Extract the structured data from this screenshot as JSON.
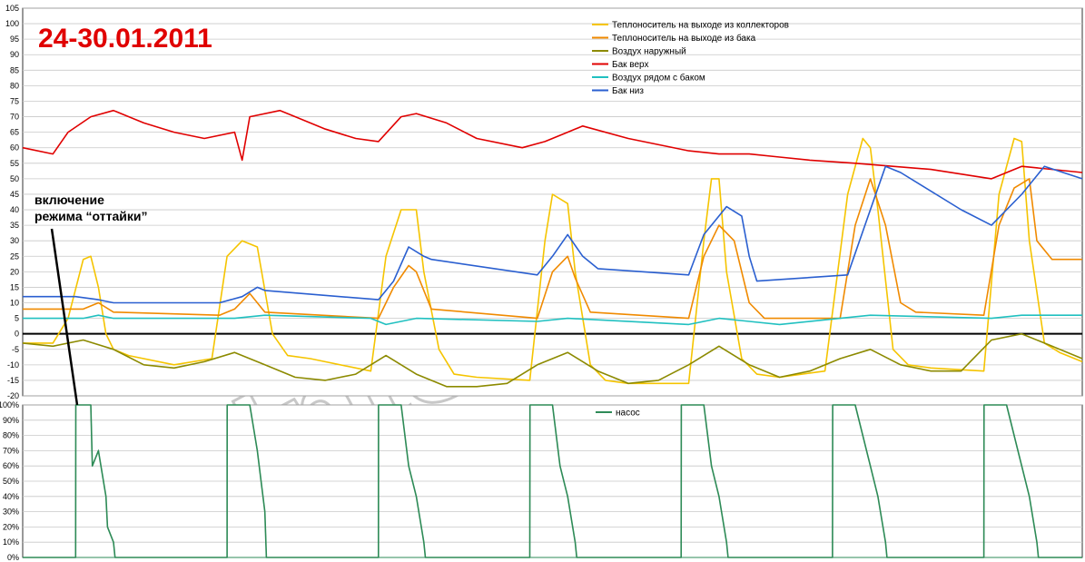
{
  "title": "24-30.01.2011",
  "annotation": "включение режима “оттайки”",
  "annotation_lines": [
    "включение",
    "режима “оттайки”"
  ],
  "watermark": "SintSolar",
  "chart_data": [
    {
      "type": "line",
      "title": "24-30.01.2011",
      "ylim": [
        -20,
        105
      ],
      "y_ticks": [
        -20,
        -15,
        -10,
        -5,
        0,
        5,
        10,
        15,
        20,
        25,
        30,
        35,
        40,
        45,
        50,
        55,
        60,
        65,
        70,
        75,
        80,
        85,
        90,
        95,
        100,
        105
      ],
      "grid": true,
      "legend_position": "top-right",
      "x_range": [
        0,
        7
      ],
      "series": [
        {
          "name": "Теплоноситель на выходе из коллекторов",
          "color": "#f5c400",
          "x": [
            0,
            0.2,
            0.3,
            0.4,
            0.45,
            0.5,
            0.55,
            0.6,
            0.7,
            1.0,
            1.25,
            1.35,
            1.45,
            1.55,
            1.65,
            1.75,
            1.9,
            2.3,
            2.4,
            2.5,
            2.6,
            2.65,
            2.75,
            2.85,
            3.0,
            3.35,
            3.45,
            3.5,
            3.6,
            3.65,
            3.75,
            3.85,
            4.0,
            4.4,
            4.5,
            4.55,
            4.6,
            4.65,
            4.75,
            4.85,
            5.0,
            5.3,
            5.45,
            5.55,
            5.6,
            5.65,
            5.75,
            5.85,
            6.0,
            6.35,
            6.45,
            6.55,
            6.6,
            6.65,
            6.75,
            6.85,
            7.0
          ],
          "values": [
            -3,
            -3,
            5,
            24,
            25,
            15,
            0,
            -5,
            -7,
            -10,
            -8,
            25,
            30,
            28,
            0,
            -7,
            -8,
            -12,
            25,
            40,
            40,
            20,
            -5,
            -13,
            -14,
            -15,
            30,
            45,
            42,
            20,
            -10,
            -15,
            -16,
            -16,
            30,
            50,
            50,
            20,
            -8,
            -13,
            -14,
            -12,
            45,
            63,
            60,
            40,
            -5,
            -10,
            -11,
            -12,
            45,
            63,
            62,
            30,
            -3,
            -6,
            -9
          ]
        },
        {
          "name": "Теплоноситель на выходе из бака",
          "color": "#f08a00",
          "x": [
            0,
            0.4,
            0.5,
            0.6,
            1.3,
            1.4,
            1.5,
            1.6,
            2.35,
            2.45,
            2.55,
            2.6,
            2.7,
            3.4,
            3.5,
            3.6,
            3.65,
            3.75,
            4.4,
            4.5,
            4.6,
            4.7,
            4.8,
            4.9,
            5.4,
            5.5,
            5.6,
            5.7,
            5.8,
            5.9,
            6.35,
            6.45,
            6.55,
            6.65,
            6.7,
            6.8,
            7.0
          ],
          "values": [
            8,
            8,
            10,
            7,
            6,
            8,
            13,
            7,
            5,
            15,
            22,
            20,
            8,
            5,
            20,
            25,
            18,
            7,
            5,
            25,
            35,
            30,
            10,
            5,
            5,
            35,
            50,
            35,
            10,
            7,
            6,
            35,
            47,
            50,
            30,
            24,
            24
          ]
        },
        {
          "name": "Воздух наружный",
          "color": "#8c8a00",
          "x": [
            0,
            0.2,
            0.4,
            0.6,
            0.8,
            1.0,
            1.2,
            1.4,
            1.6,
            1.8,
            2.0,
            2.2,
            2.4,
            2.6,
            2.8,
            3.0,
            3.2,
            3.4,
            3.6,
            3.8,
            4.0,
            4.2,
            4.4,
            4.6,
            4.8,
            5.0,
            5.2,
            5.4,
            5.6,
            5.8,
            6.0,
            6.2,
            6.4,
            6.6,
            6.8,
            7.0
          ],
          "values": [
            -3,
            -4,
            -2,
            -5,
            -10,
            -11,
            -9,
            -6,
            -10,
            -14,
            -15,
            -13,
            -7,
            -13,
            -17,
            -17,
            -16,
            -10,
            -6,
            -12,
            -16,
            -15,
            -10,
            -4,
            -10,
            -14,
            -12,
            -8,
            -5,
            -10,
            -12,
            -12,
            -2,
            0,
            -4,
            -8
          ]
        },
        {
          "name": "Бак верх",
          "color": "#e00000",
          "x": [
            0,
            0.2,
            0.3,
            0.45,
            0.6,
            0.8,
            1.0,
            1.2,
            1.4,
            1.45,
            1.5,
            1.7,
            2.0,
            2.2,
            2.35,
            2.5,
            2.6,
            2.8,
            3.0,
            3.3,
            3.45,
            3.6,
            3.7,
            4.0,
            4.4,
            4.6,
            4.8,
            5.0,
            5.2,
            5.5,
            6.0,
            6.4,
            6.6,
            7.0
          ],
          "values": [
            60,
            58,
            65,
            70,
            72,
            68,
            65,
            63,
            65,
            56,
            70,
            72,
            66,
            63,
            62,
            70,
            71,
            68,
            63,
            60,
            62,
            65,
            67,
            63,
            59,
            58,
            58,
            57,
            56,
            55,
            53,
            50,
            54,
            52
          ]
        },
        {
          "name": "Воздух рядом с баком",
          "color": "#20c0c0",
          "x": [
            0,
            0.4,
            0.5,
            0.6,
            1.4,
            1.6,
            2.3,
            2.4,
            2.6,
            3.4,
            3.6,
            4.4,
            4.6,
            4.8,
            5.0,
            5.4,
            5.6,
            6.4,
            6.6,
            7.0
          ],
          "values": [
            5,
            5,
            6,
            5,
            5,
            6,
            5,
            3,
            5,
            4,
            5,
            3,
            5,
            4,
            3,
            5,
            6,
            5,
            6,
            6
          ]
        },
        {
          "name": "Бак низ",
          "color": "#2a5fd0",
          "x": [
            0,
            0.35,
            0.5,
            0.6,
            1.3,
            1.45,
            1.55,
            1.6,
            2.35,
            2.45,
            2.55,
            2.65,
            2.7,
            3.4,
            3.5,
            3.6,
            3.7,
            3.8,
            4.4,
            4.5,
            4.65,
            4.75,
            4.8,
            4.85,
            5.45,
            5.6,
            5.7,
            5.8,
            6.2,
            6.4,
            6.6,
            6.75,
            7.0
          ],
          "values": [
            12,
            12,
            11,
            10,
            10,
            12,
            15,
            14,
            11,
            17,
            28,
            25,
            24,
            19,
            25,
            32,
            25,
            21,
            19,
            32,
            41,
            38,
            25,
            17,
            19,
            40,
            54,
            52,
            40,
            35,
            45,
            54,
            50
          ]
        }
      ]
    },
    {
      "type": "line",
      "ylim": [
        0,
        100
      ],
      "y_ticks": [
        "0%",
        "10%",
        "20%",
        "30%",
        "40%",
        "50%",
        "60%",
        "70%",
        "80%",
        "90%",
        "100%"
      ],
      "y_tick_values": [
        0,
        10,
        20,
        30,
        40,
        50,
        60,
        70,
        80,
        90,
        100
      ],
      "grid": true,
      "legend_position": "top-center",
      "x_range": [
        0,
        7
      ],
      "series": [
        {
          "name": "насос",
          "color": "#2e8b57",
          "x": [
            0,
            0.35,
            0.351,
            0.45,
            0.46,
            0.5,
            0.55,
            0.56,
            0.6,
            0.61,
            1.35,
            1.351,
            1.5,
            1.55,
            1.6,
            1.61,
            2.35,
            2.351,
            2.5,
            2.55,
            2.6,
            2.65,
            2.66,
            3.35,
            3.351,
            3.5,
            3.55,
            3.6,
            3.65,
            3.66,
            4.35,
            4.351,
            4.5,
            4.55,
            4.6,
            4.65,
            4.66,
            5.35,
            5.351,
            5.5,
            5.6,
            5.65,
            5.7,
            5.71,
            6.35,
            6.351,
            6.5,
            6.6,
            6.65,
            6.7,
            6.71,
            7.0
          ],
          "values": [
            0,
            0,
            100,
            100,
            60,
            70,
            40,
            20,
            10,
            0,
            0,
            100,
            100,
            70,
            30,
            0,
            0,
            100,
            100,
            60,
            40,
            10,
            0,
            0,
            100,
            100,
            60,
            40,
            10,
            0,
            0,
            100,
            100,
            60,
            40,
            10,
            0,
            0,
            100,
            100,
            60,
            40,
            10,
            0,
            0,
            100,
            100,
            60,
            40,
            10,
            0,
            0
          ]
        }
      ]
    }
  ]
}
